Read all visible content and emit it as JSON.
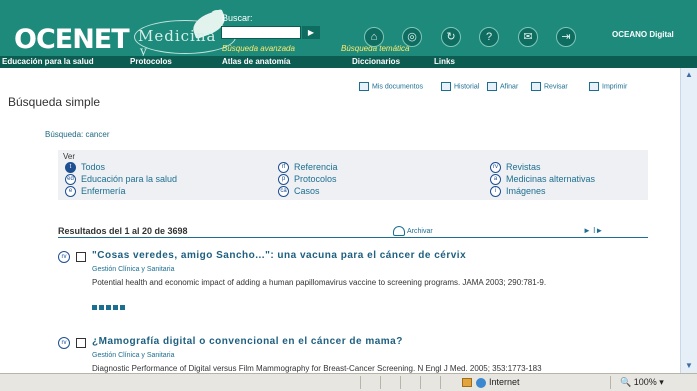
{
  "header": {
    "logo_main": "OCENET",
    "logo_sub_1": "Medicina",
    "logo_sub_2": "y Salud",
    "search_label": "Buscar:",
    "search_value": "",
    "advanced_search": "Búsqueda avanzada",
    "thematic_search": "Búsqueda temática",
    "brand": "OCEANO Digital"
  },
  "nav": [
    "Educación para la salud",
    "Protocolos",
    "Atlas de anatomía",
    "Diccionarios",
    "Links"
  ],
  "toolbar": [
    "Mis documentos",
    "Historial",
    "Afinar",
    "Revisar",
    "Imprimir"
  ],
  "page": {
    "title": "Búsqueda simple",
    "query": "Búsqueda: cancer"
  },
  "filters": {
    "label": "Ver",
    "items": [
      {
        "code": "t",
        "label": "Todos"
      },
      {
        "code": "ed",
        "label": "Educación para la salud"
      },
      {
        "code": "e",
        "label": "Enfermería"
      },
      {
        "code": "rf",
        "label": "Referencia"
      },
      {
        "code": "p",
        "label": "Protocolos"
      },
      {
        "code": "ca",
        "label": "Casos"
      },
      {
        "code": "rv",
        "label": "Revistas"
      },
      {
        "code": "a",
        "label": "Medicinas alternativas"
      },
      {
        "code": "i",
        "label": "Imágenes"
      }
    ]
  },
  "results": {
    "summary": "Resultados del 1 al 20 de 3698",
    "archive_label": "Archivar",
    "pager": "► I►",
    "items": [
      {
        "type": "rv",
        "title": "\"Cosas veredes, amigo Sancho...\": una vacuna para el cáncer de cérvix",
        "source": "Gestión Clínica y Sanitaria",
        "description": "Potential health and economic impact of adding a human papillomavirus vaccine to screening programs. JAMA 2003; 290:781-9.",
        "rating": 5
      },
      {
        "type": "rv",
        "title": "¿Mamografía digital o convencional en el cáncer de mama?",
        "source": "Gestión Clínica y Sanitaria",
        "description": "Diagnostic Performance of Digital versus Film Mammography for Breast-Cancer Screening. N Engl J Med. 2005; 353:1773-183",
        "rating": 0
      }
    ]
  },
  "statusbar": {
    "zone": "Internet",
    "zoom": "100%"
  }
}
